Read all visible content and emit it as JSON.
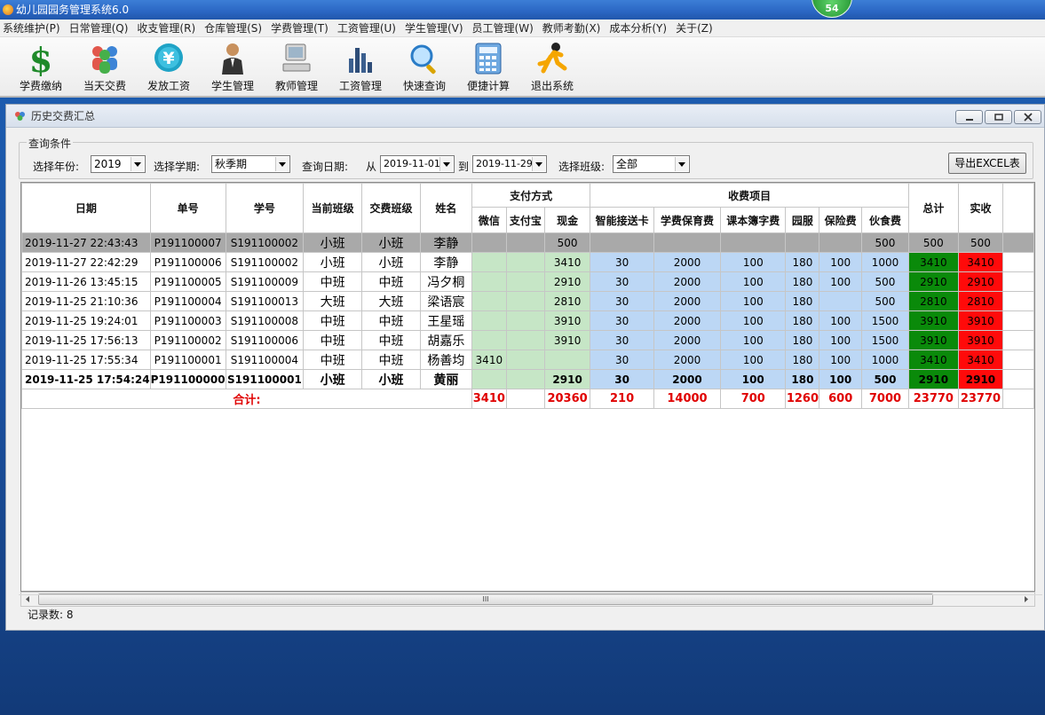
{
  "app": {
    "title": "幼儿园园务管理系统6.0",
    "badge": "54"
  },
  "menu": [
    "系统维护(P)",
    "日常管理(Q)",
    "收支管理(R)",
    "仓库管理(S)",
    "学费管理(T)",
    "工资管理(U)",
    "学生管理(V)",
    "员工管理(W)",
    "教师考勤(X)",
    "成本分析(Y)",
    "关于(Z)"
  ],
  "toolbar": [
    {
      "label": "学费缴纳",
      "icon": "dollar-icon"
    },
    {
      "label": "当天交费",
      "icon": "people-icon"
    },
    {
      "label": "发放工资",
      "icon": "yen-icon"
    },
    {
      "label": "学生管理",
      "icon": "person-icon"
    },
    {
      "label": "教师管理",
      "icon": "computer-icon"
    },
    {
      "label": "工资管理",
      "icon": "chart-icon"
    },
    {
      "label": "快速查询",
      "icon": "magnifier-icon"
    },
    {
      "label": "便捷计算",
      "icon": "calculator-icon"
    },
    {
      "label": "退出系统",
      "icon": "exit-runner-icon"
    }
  ],
  "window": {
    "title": "历史交费汇总"
  },
  "query": {
    "legend": "查询条件",
    "year_label": "选择年份:",
    "year": "2019",
    "term_label": "选择学期:",
    "term": "秋季期",
    "date_label": "查询日期:",
    "from_label": "从",
    "from": "2019-11-01",
    "to_label": "到",
    "to": "2019-11-29",
    "class_label": "选择班级:",
    "class": "全部",
    "export": "导出EXCEL表"
  },
  "grid": {
    "headers": {
      "date": "日期",
      "order": "单号",
      "sid": "学号",
      "cur_class": "当前班级",
      "pay_class": "交费班级",
      "name": "姓名",
      "pay_group": "支付方式",
      "wechat": "微信",
      "alipay": "支付宝",
      "cash": "现金",
      "fee_group": "收费项目",
      "pickup": "智能接送卡",
      "tuition": "学费保育费",
      "books": "课本簿字费",
      "uniform": "园服",
      "insurance": "保险费",
      "meal": "伙食费",
      "total": "总计",
      "actual": "实收"
    },
    "rows": [
      {
        "date": "2019-11-27 22:43:43",
        "order": "P191100007",
        "sid": "S191100002",
        "cur_class": "小班",
        "pay_class": "小班",
        "name": "李静",
        "wechat": "",
        "alipay": "",
        "cash": "500",
        "pickup": "",
        "tuition": "",
        "books": "",
        "uniform": "",
        "insurance": "",
        "meal": "500",
        "total": "500",
        "actual": "500"
      },
      {
        "date": "2019-11-27 22:42:29",
        "order": "P191100006",
        "sid": "S191100002",
        "cur_class": "小班",
        "pay_class": "小班",
        "name": "李静",
        "wechat": "",
        "alipay": "",
        "cash": "3410",
        "pickup": "30",
        "tuition": "2000",
        "books": "100",
        "uniform": "180",
        "insurance": "100",
        "meal": "1000",
        "total": "3410",
        "actual": "3410"
      },
      {
        "date": "2019-11-26 13:45:15",
        "order": "P191100005",
        "sid": "S191100009",
        "cur_class": "中班",
        "pay_class": "中班",
        "name": "冯夕桐",
        "wechat": "",
        "alipay": "",
        "cash": "2910",
        "pickup": "30",
        "tuition": "2000",
        "books": "100",
        "uniform": "180",
        "insurance": "100",
        "meal": "500",
        "total": "2910",
        "actual": "2910"
      },
      {
        "date": "2019-11-25 21:10:36",
        "order": "P191100004",
        "sid": "S191100013",
        "cur_class": "大班",
        "pay_class": "大班",
        "name": "梁语宸",
        "wechat": "",
        "alipay": "",
        "cash": "2810",
        "pickup": "30",
        "tuition": "2000",
        "books": "100",
        "uniform": "180",
        "insurance": "",
        "meal": "500",
        "total": "2810",
        "actual": "2810"
      },
      {
        "date": "2019-11-25 19:24:01",
        "order": "P191100003",
        "sid": "S191100008",
        "cur_class": "中班",
        "pay_class": "中班",
        "name": "王星瑶",
        "wechat": "",
        "alipay": "",
        "cash": "3910",
        "pickup": "30",
        "tuition": "2000",
        "books": "100",
        "uniform": "180",
        "insurance": "100",
        "meal": "1500",
        "total": "3910",
        "actual": "3910"
      },
      {
        "date": "2019-11-25 17:56:13",
        "order": "P191100002",
        "sid": "S191100006",
        "cur_class": "中班",
        "pay_class": "中班",
        "name": "胡嘉乐",
        "wechat": "",
        "alipay": "",
        "cash": "3910",
        "pickup": "30",
        "tuition": "2000",
        "books": "100",
        "uniform": "180",
        "insurance": "100",
        "meal": "1500",
        "total": "3910",
        "actual": "3910"
      },
      {
        "date": "2019-11-25 17:55:34",
        "order": "P191100001",
        "sid": "S191100004",
        "cur_class": "中班",
        "pay_class": "中班",
        "name": "杨善均",
        "wechat": "3410",
        "alipay": "",
        "cash": "",
        "pickup": "30",
        "tuition": "2000",
        "books": "100",
        "uniform": "180",
        "insurance": "100",
        "meal": "1000",
        "total": "3410",
        "actual": "3410"
      },
      {
        "date": "2019-11-25 17:54:24",
        "order": "P191100000",
        "sid": "S191100001",
        "cur_class": "小班",
        "pay_class": "小班",
        "name": "黄丽",
        "wechat": "",
        "alipay": "",
        "cash": "2910",
        "pickup": "30",
        "tuition": "2000",
        "books": "100",
        "uniform": "180",
        "insurance": "100",
        "meal": "500",
        "total": "2910",
        "actual": "2910"
      }
    ],
    "summary": {
      "label": "合计:",
      "wechat": "3410",
      "alipay": "",
      "cash": "20360",
      "pickup": "210",
      "tuition": "14000",
      "books": "700",
      "uniform": "1260",
      "insurance": "600",
      "meal": "7000",
      "total": "23770",
      "actual": "23770"
    }
  },
  "scroll_marker": "III",
  "status": {
    "label": "记录数:",
    "count": "8"
  },
  "colors": {
    "pay": "#c6e6c6",
    "fee": "#bcd7f5",
    "total": "#0a8a0a",
    "actual": "#ff0a0a",
    "summary_text": "#e00000",
    "selected_row": "#a9a9a9"
  }
}
